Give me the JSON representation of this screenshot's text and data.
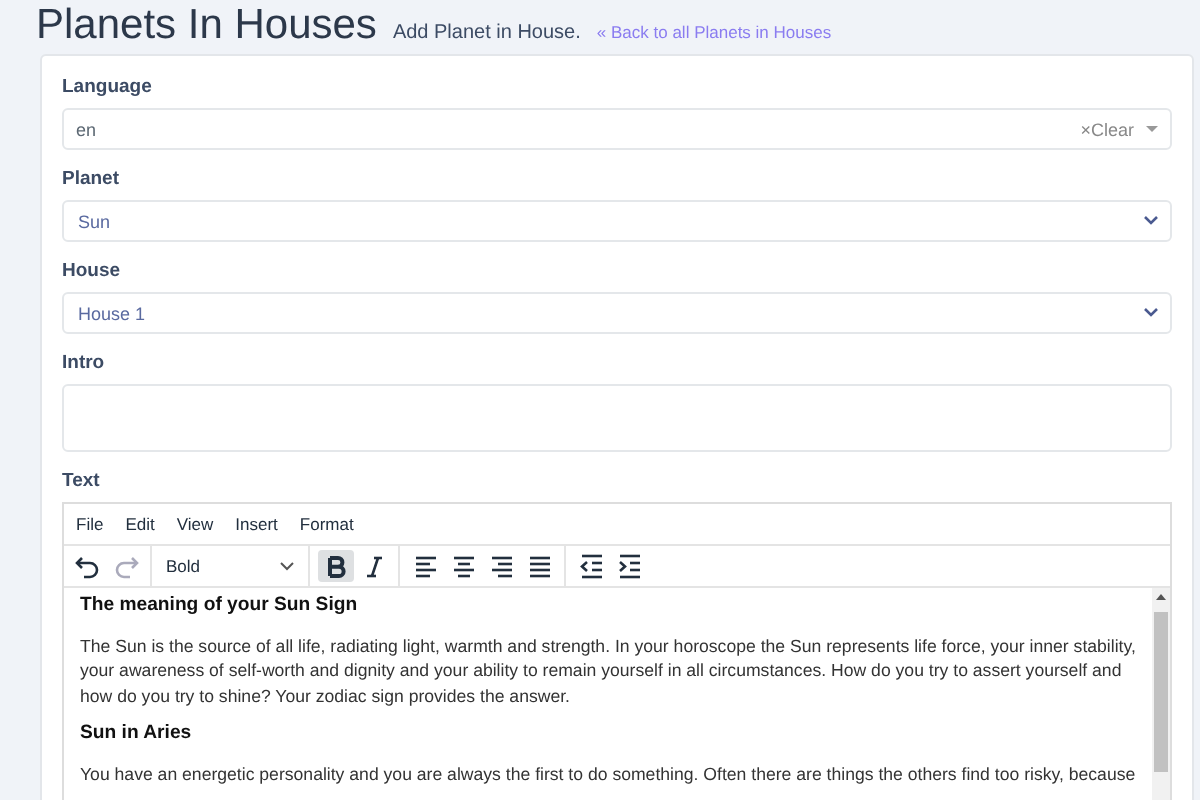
{
  "header": {
    "title": "Planets In Houses",
    "subtitle": "Add Planet in House.",
    "back_icon": "«",
    "back_link": "Back to all Planets in Houses"
  },
  "fields": [
    {
      "kind": "combo",
      "label": "Language",
      "value": "en",
      "clear": "×Clear"
    },
    {
      "kind": "select",
      "label": "Planet",
      "value": "Sun"
    },
    {
      "kind": "select",
      "label": "House",
      "value": "House 1"
    },
    {
      "kind": "textarea",
      "label": "Intro"
    }
  ],
  "editor": {
    "label": "Text",
    "menu": [
      "File",
      "Edit",
      "View",
      "Insert",
      "Format"
    ],
    "toolbar": [
      {
        "kind": "undo"
      },
      {
        "kind": "redo"
      },
      {
        "kind": "sep"
      },
      {
        "kind": "dropdown",
        "label": "Bold"
      },
      {
        "kind": "sep"
      },
      {
        "kind": "bold",
        "selected": true
      },
      {
        "kind": "italic",
        "selected": false
      },
      {
        "kind": "sep"
      },
      {
        "kind": "align-left"
      },
      {
        "kind": "align-center"
      },
      {
        "kind": "align-right"
      },
      {
        "kind": "align-justify"
      },
      {
        "kind": "sep"
      },
      {
        "kind": "outdent"
      },
      {
        "kind": "indent"
      }
    ],
    "content": [
      {
        "kind": "heading",
        "text": "The meaning of your Sun Sign"
      },
      {
        "kind": "paragraph",
        "text": "The Sun is the source of all life, radiating light, warmth and strength. In your horoscope the Sun represents life force, your inner stability, your awareness of self-worth and dignity and your ability to remain yourself in all circumstances. How do you try to assert yourself and how do you try to shine? Your zodiac sign provides the answer."
      },
      {
        "kind": "heading",
        "text": "Sun in Aries"
      },
      {
        "kind": "paragraph",
        "text": "You have an energetic personality and you are always the first to do something. Often there are things the others find too risky, because"
      }
    ]
  }
}
